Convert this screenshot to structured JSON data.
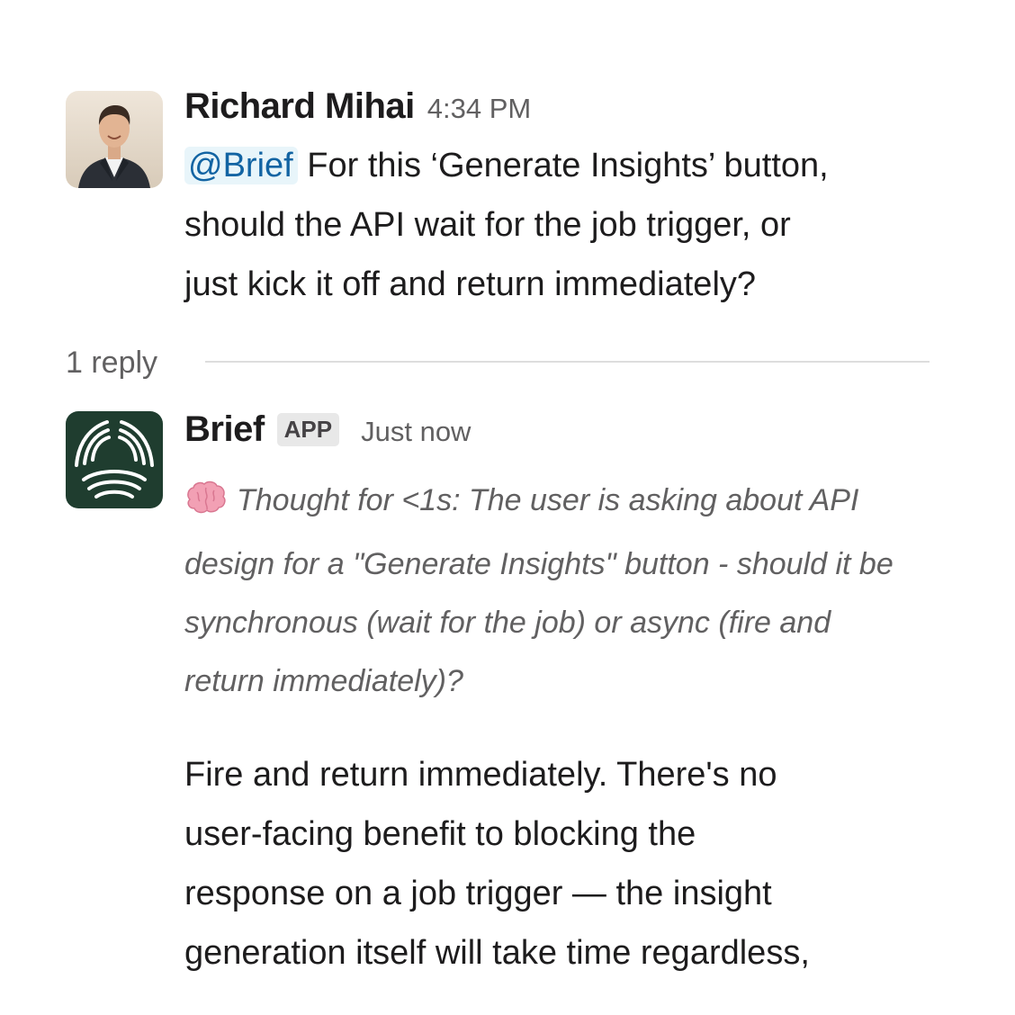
{
  "message1": {
    "sender": "Richard Mihai",
    "time": "4:34 PM",
    "mention": "@Brief",
    "text_line1": "For this ‘Generate Insights’ button,",
    "text_line2": "should the API wait for the job trigger, or",
    "text_line3": "just kick it off and return immediately?"
  },
  "thread": {
    "reply_count": "1 reply"
  },
  "message2": {
    "sender": "Brief",
    "badge": "APP",
    "time": "Just now",
    "thought_icon": "brain-icon",
    "thought_line1": "Thought for <1s: The user is asking about API",
    "thought_line2": "design for a \"Generate Insights\" button - should it be",
    "thought_line3": "synchronous (wait for the job) or async (fire and",
    "thought_line4": "return immediately)?",
    "body_line1": "Fire and return immediately. There's no",
    "body_line2": "user-facing benefit to blocking the",
    "body_line3": "response on a job trigger — the insight",
    "body_line4": "generation itself will take time regardless,"
  },
  "colors": {
    "mention_bg": "#e8f5fa",
    "mention_text": "#1264a3",
    "brief_logo_bg": "#1f3d2f"
  }
}
